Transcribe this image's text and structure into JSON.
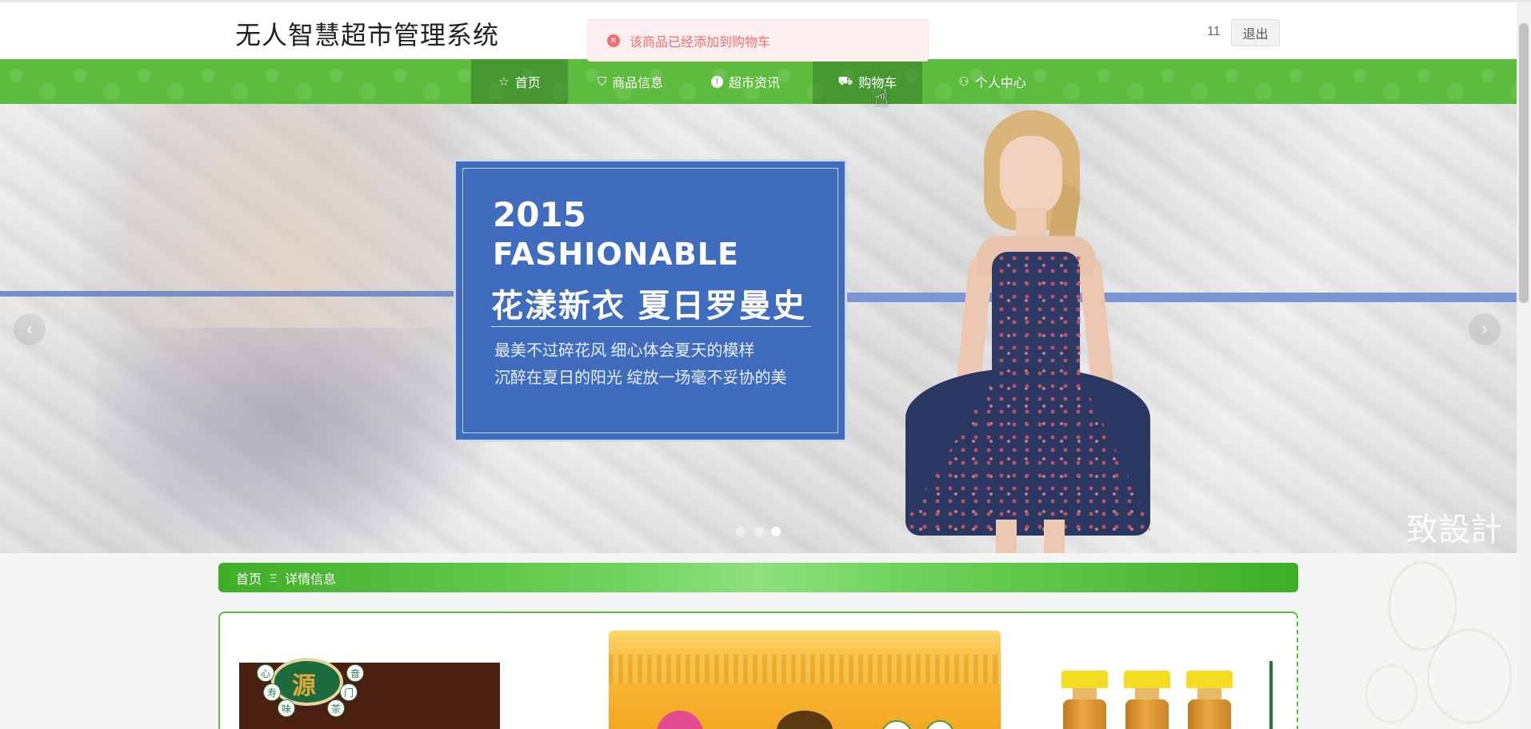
{
  "header": {
    "site_title": "无人智慧超市管理系统",
    "username": "11",
    "logout_label": "退出"
  },
  "toast": {
    "type": "error",
    "message": "该商品已经添加到购物车"
  },
  "nav": {
    "items": [
      {
        "icon": "star-icon",
        "glyph": "☆",
        "label": "首页"
      },
      {
        "icon": "shopping-bag-icon",
        "glyph": "⛉",
        "label": "商品信息"
      },
      {
        "icon": "info-icon",
        "glyph": "!",
        "label": "超市资讯"
      },
      {
        "icon": "cart-icon",
        "glyph": "⛟",
        "label": "购物车"
      },
      {
        "icon": "user-icon",
        "glyph": "⚇",
        "label": "个人中心"
      }
    ]
  },
  "banner": {
    "card_year": "2015",
    "card_word": "FASHIONABLE",
    "card_headline": "花漾新衣  夏日罗曼史",
    "card_line1": "最美不过碎花风 细心体会夏天的模样",
    "card_line2": "沉醉在夏日的阳光 绽放一场毫不妥协的美",
    "watermark": "致設計",
    "slide_count": 3,
    "active_slide": 3,
    "prev_glyph": "‹",
    "next_glyph": "›"
  },
  "breadcrumb": {
    "home": "首页",
    "separator": "Ξ",
    "current": "详情信息"
  },
  "products": {
    "logo_text": "源",
    "seal_chars": [
      "心",
      "音",
      "寿",
      "门",
      "味",
      "茶"
    ]
  },
  "colors": {
    "nav_green": "#5dbb3d",
    "breadcrumb_green": "#3fae27",
    "toast_red": "#f56c6c",
    "card_blue": "#3f6cbd"
  }
}
